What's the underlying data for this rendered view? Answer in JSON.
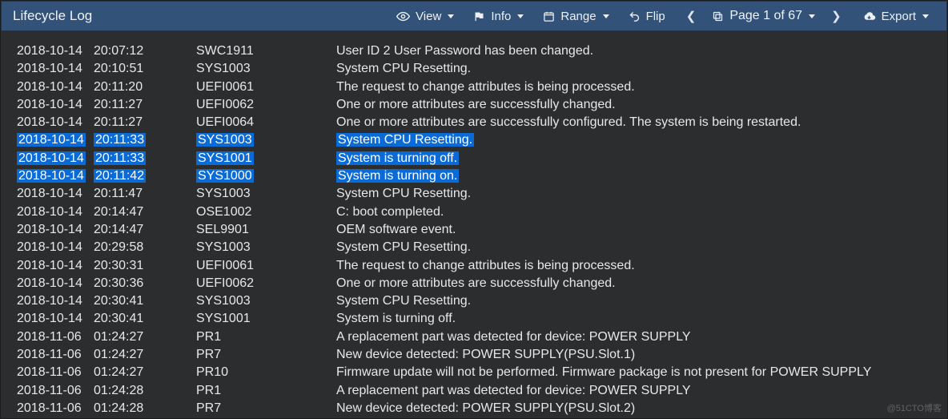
{
  "header": {
    "title": "Lifecycle Log",
    "view": "View",
    "info": "Info",
    "range": "Range",
    "flip": "Flip",
    "export": "Export",
    "page": "Page 1 of 67"
  },
  "log": {
    "rows": [
      {
        "date": "2018-10-14",
        "time": "20:07:12",
        "code": "SWC1911",
        "desc": "User ID 2 User Password has been changed.",
        "sel": false
      },
      {
        "date": "2018-10-14",
        "time": "20:10:51",
        "code": "SYS1003",
        "desc": "System CPU Resetting.",
        "sel": false
      },
      {
        "date": "2018-10-14",
        "time": "20:11:20",
        "code": "UEFI0061",
        "desc": "The request to change attributes is being processed.",
        "sel": false
      },
      {
        "date": "2018-10-14",
        "time": "20:11:27",
        "code": "UEFI0062",
        "desc": "One or more attributes are successfully changed.",
        "sel": false
      },
      {
        "date": "2018-10-14",
        "time": "20:11:27",
        "code": "UEFI0064",
        "desc": "One or more attributes are successfully configured. The system is being restarted.",
        "sel": false
      },
      {
        "date": "2018-10-14",
        "time": "20:11:33",
        "code": "SYS1003",
        "desc": "System CPU Resetting.",
        "sel": true
      },
      {
        "date": "2018-10-14",
        "time": "20:11:33",
        "code": "SYS1001",
        "desc": "System is turning off.",
        "sel": true
      },
      {
        "date": "2018-10-14",
        "time": "20:11:42",
        "code": "SYS1000",
        "desc": "System is turning on.",
        "sel": true
      },
      {
        "date": "2018-10-14",
        "time": "20:11:47",
        "code": "SYS1003",
        "desc": "System CPU Resetting.",
        "sel": false
      },
      {
        "date": "2018-10-14",
        "time": "20:14:47",
        "code": "OSE1002",
        "desc": "C: boot completed.",
        "sel": false
      },
      {
        "date": "2018-10-14",
        "time": "20:14:47",
        "code": "SEL9901",
        "desc": "OEM software event.",
        "sel": false
      },
      {
        "date": "2018-10-14",
        "time": "20:29:58",
        "code": "SYS1003",
        "desc": "System CPU Resetting.",
        "sel": false
      },
      {
        "date": "2018-10-14",
        "time": "20:30:31",
        "code": "UEFI0061",
        "desc": "The request to change attributes is being processed.",
        "sel": false
      },
      {
        "date": "2018-10-14",
        "time": "20:30:36",
        "code": "UEFI0062",
        "desc": "One or more attributes are successfully changed.",
        "sel": false
      },
      {
        "date": "2018-10-14",
        "time": "20:30:41",
        "code": "SYS1003",
        "desc": "System CPU Resetting.",
        "sel": false
      },
      {
        "date": "2018-10-14",
        "time": "20:30:41",
        "code": "SYS1001",
        "desc": "System is turning off.",
        "sel": false
      },
      {
        "date": "2018-11-06",
        "time": "01:24:27",
        "code": "PR1",
        "desc": "A replacement part was detected for device: POWER SUPPLY",
        "sel": false
      },
      {
        "date": "2018-11-06",
        "time": "01:24:27",
        "code": "PR7",
        "desc": "New device detected: POWER SUPPLY(PSU.Slot.1)",
        "sel": false
      },
      {
        "date": "2018-11-06",
        "time": "01:24:27",
        "code": "PR10",
        "desc": "Firmware update will not be performed. Firmware package is not present for POWER SUPPLY",
        "sel": false
      },
      {
        "date": "2018-11-06",
        "time": "01:24:28",
        "code": "PR1",
        "desc": "A replacement part was detected for device: POWER SUPPLY",
        "sel": false
      },
      {
        "date": "2018-11-06",
        "time": "01:24:28",
        "code": "PR7",
        "desc": "New device detected: POWER SUPPLY(PSU.Slot.2)",
        "sel": false
      }
    ]
  },
  "watermark": "@51CTO博客"
}
